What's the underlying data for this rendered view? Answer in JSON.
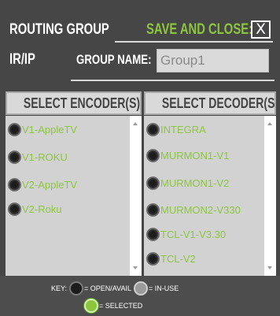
{
  "header": {
    "title": "ROUTING GROUP",
    "save_close_label": "SAVE AND CLOSE:",
    "close_glyph": "X",
    "subtitle": "IR/IP",
    "group_name_label": "GROUP NAME:",
    "group_name_value": "Group1"
  },
  "encoders": {
    "header": "SELECT ENCODER(S)",
    "items": [
      {
        "label": "V1-AppleTV",
        "state": "open"
      },
      {
        "label": "V1-ROKU",
        "state": "open"
      },
      {
        "label": "V2-AppleTV",
        "state": "open"
      },
      {
        "label": "V2-Roku",
        "state": "open"
      }
    ]
  },
  "decoders": {
    "header": "SELECT DECODER(S)",
    "items": [
      {
        "label": "INTEGRA",
        "state": "open"
      },
      {
        "label": "MURMON1-V1",
        "state": "open"
      },
      {
        "label": "MURMON1-V2",
        "state": "open"
      },
      {
        "label": "MURMON2-V330",
        "state": "open"
      },
      {
        "label": "TCL-V1-V3.30",
        "state": "open"
      },
      {
        "label": "TCL-V2",
        "state": "open"
      }
    ]
  },
  "key": {
    "prefix": "KEY:",
    "open_label": "= OPEN/AVAIL",
    "inuse_label": "= IN-USE",
    "selected_label": "= SELECTED"
  },
  "colors": {
    "accent": "#8cc63f",
    "background": "#464646",
    "panel": "#d2d2d2"
  }
}
